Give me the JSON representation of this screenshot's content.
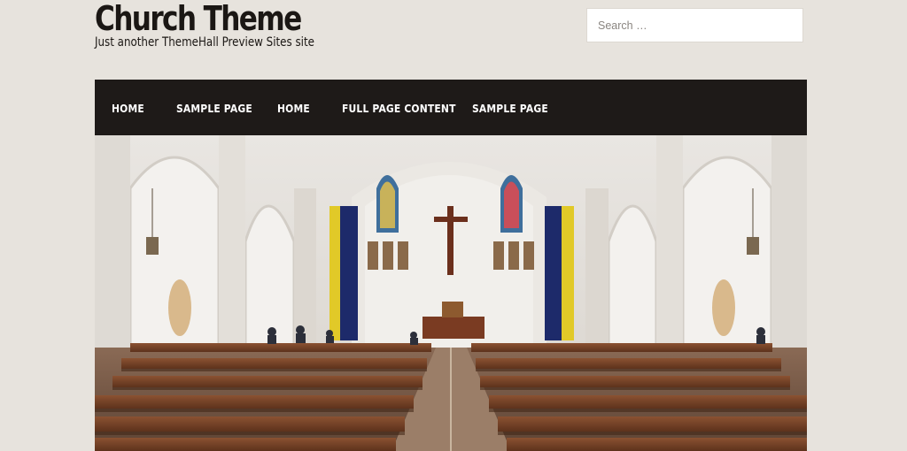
{
  "site": {
    "title": "Church Theme",
    "tagline": "Just another ThemeHall Preview Sites site"
  },
  "search": {
    "placeholder": "Search …",
    "icon": "none"
  },
  "nav": {
    "items": [
      {
        "label": "HOME"
      },
      {
        "label": "SAMPLE PAGE"
      },
      {
        "label": "HOME"
      },
      {
        "label": "FULL PAGE CONTENT"
      },
      {
        "label": "SAMPLE PAGE"
      }
    ]
  },
  "hero": {
    "image": "church-interior-photo"
  },
  "colors": {
    "background": "#e7e3dd",
    "nav_background": "#1e1a18",
    "nav_text": "#ffffff",
    "title_text": "#1b1714"
  }
}
